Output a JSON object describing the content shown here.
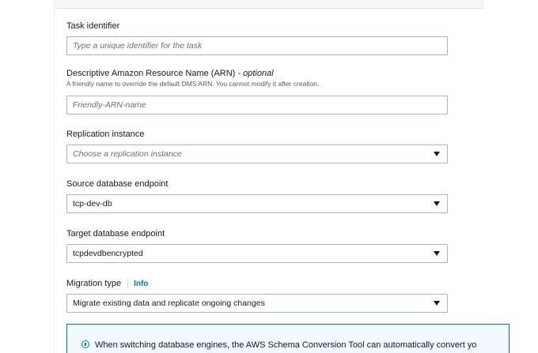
{
  "form": {
    "task_identifier": {
      "label": "Task identifier",
      "placeholder": "Type a unique identifier for the task"
    },
    "arn": {
      "label": "Descriptive Amazon Resource Name (ARN)",
      "optional": "- optional",
      "description": "A friendly name to override the default DMS ARN. You cannot modify it after creation.",
      "placeholder": "Friendly-ARN-name"
    },
    "replication_instance": {
      "label": "Replication instance",
      "placeholder": "Choose a replication instance"
    },
    "source_endpoint": {
      "label": "Source database endpoint",
      "value": "tcp-dev-db"
    },
    "target_endpoint": {
      "label": "Target database endpoint",
      "value": "tcpdevdbencrypted"
    },
    "migration_type": {
      "label": "Migration type",
      "info_link": "Info",
      "value": "Migrate existing data and replicate ongoing changes"
    }
  },
  "alert": {
    "icon": "info-circle-icon",
    "text": "When switching database engines, the AWS Schema Conversion Tool can automatically convert yo"
  },
  "colors": {
    "link": "#0073bb",
    "border": "#aab7b8",
    "alert_background": "#f1faff"
  }
}
